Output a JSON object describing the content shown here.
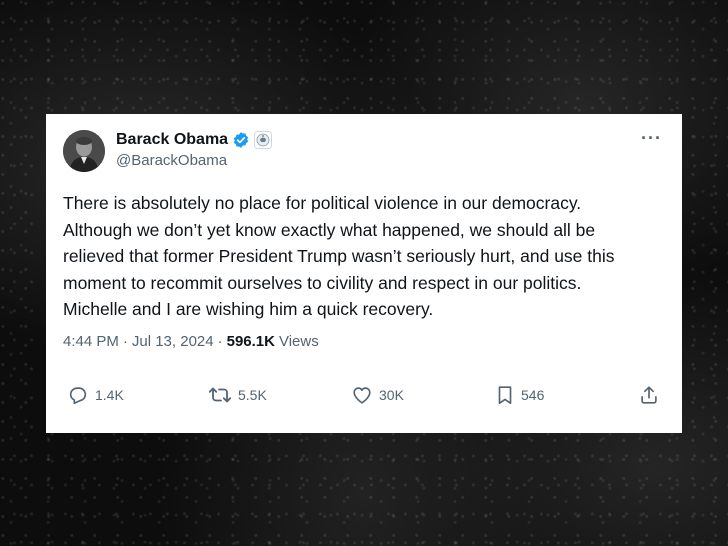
{
  "tweet": {
    "author_name": "Barack Obama",
    "handle": "@BarackObama",
    "more_label": "···",
    "icons": {
      "verified": "verified-badge-icon",
      "government": "government-affiliation-icon",
      "more": "more-options-icon"
    },
    "text_lines": [
      "There is absolutely no place for political violence in our democracy.",
      "Although we don’t yet know exactly what happened, we should all be",
      "relieved that former President Trump wasn’t seriously hurt, and use this",
      "moment to recommit ourselves to civility and respect in our politics.",
      "Michelle and I are wishing him a quick recovery."
    ],
    "time": "4:44 PM",
    "separator": "·",
    "date": "Jul 13, 2024",
    "views_count": "596.1K",
    "views_label": "Views"
  },
  "actions": {
    "replies": "1.4K",
    "retweets": "5.5K",
    "likes": "30K",
    "bookmarks": "546"
  },
  "colors": {
    "text": "#0f1419",
    "secondary": "#536471",
    "verified": "#1d9bf0",
    "background": "#0d0d0d",
    "card": "#ffffff"
  }
}
